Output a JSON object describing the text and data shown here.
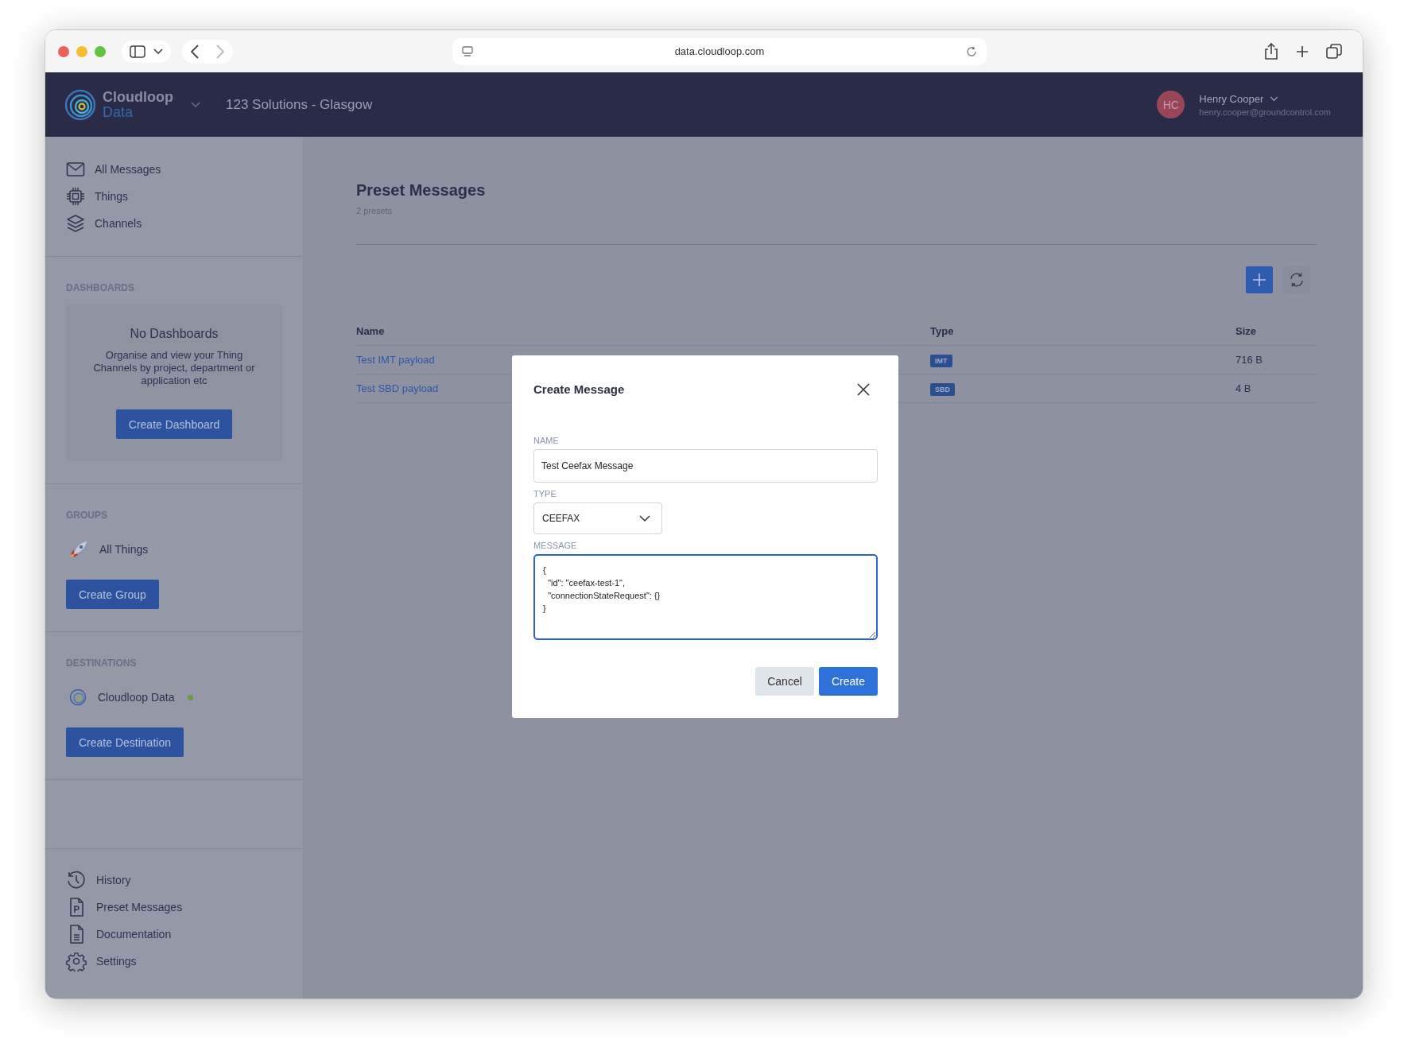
{
  "browser": {
    "url": "data.cloudloop.com"
  },
  "header": {
    "logo_top": "Cloudloop",
    "logo_bottom": "Data",
    "org": "123 Solutions - Glasgow",
    "avatar": "HC",
    "user_name": "Henry Cooper",
    "user_email": "henry.cooper@groundcontrol.com"
  },
  "sidebar": {
    "nav": [
      {
        "label": "All Messages"
      },
      {
        "label": "Things"
      },
      {
        "label": "Channels"
      }
    ],
    "dashboards": {
      "heading": "DASHBOARDS",
      "empty_title": "No Dashboards",
      "empty_text": "Organise and view your Thing Channels by project, department or application etc",
      "button": "Create Dashboard"
    },
    "groups": {
      "heading": "GROUPS",
      "items": [
        {
          "label": "All Things"
        }
      ],
      "button": "Create Group"
    },
    "destinations": {
      "heading": "DESTINATIONS",
      "items": [
        {
          "label": "Cloudloop Data",
          "color": "#6f9a3c"
        }
      ],
      "button": "Create Destination"
    },
    "footer_nav": [
      {
        "label": "History"
      },
      {
        "label": "Preset Messages"
      },
      {
        "label": "Documentation"
      },
      {
        "label": "Settings"
      }
    ]
  },
  "main": {
    "title": "Preset Messages",
    "subtitle": "2 presets",
    "columns": [
      "Name",
      "Type",
      "Size"
    ],
    "rows": [
      {
        "name": "Test IMT payload",
        "type": "IMT",
        "size": "716 B"
      },
      {
        "name": "Test SBD payload",
        "type": "SBD",
        "size": "4 B"
      }
    ]
  },
  "modal": {
    "title": "Create Message",
    "name_label": "NAME",
    "name_value": "Test Ceefax Message",
    "type_label": "TYPE",
    "type_value": "CEEFAX",
    "message_label": "MESSAGE",
    "message_value": "{\n  \"id\": \"ceefax-test-1\",\n  \"connectionStateRequest\": {}\n}",
    "cancel": "Cancel",
    "create": "Create"
  }
}
